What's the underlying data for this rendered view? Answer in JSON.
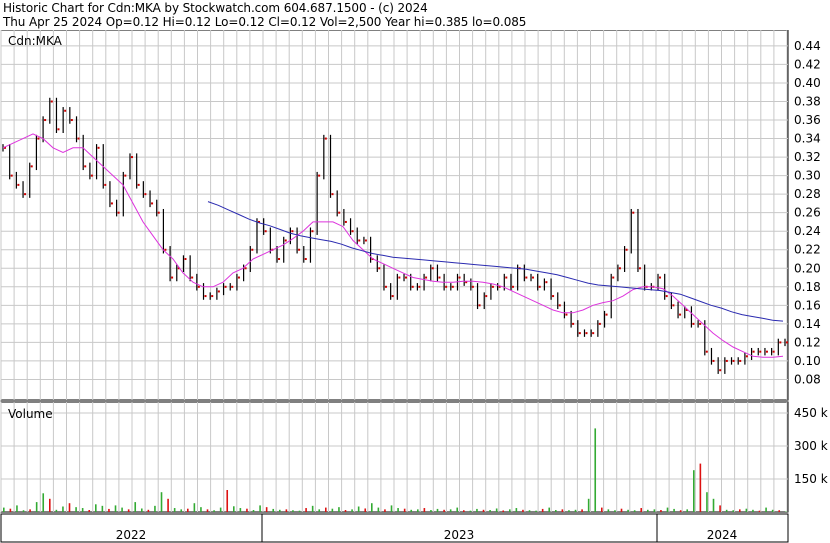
{
  "header": {
    "line1": "Historic Chart for Cdn:MKA by Stockwatch.com 604.687.1500 - (c) 2024",
    "line2": "Thu Apr 25 2024  Op=0.12  Hi=0.12  Lo=0.12  Cl=0.12  Vol=2,500  Year hi=0.385  lo=0.085"
  },
  "chart_data": [
    {
      "type": "ohlc",
      "panel": "price",
      "label": "Cdn:MKA",
      "y_ticks": [
        "0.08",
        "0.10",
        "0.12",
        "0.14",
        "0.16",
        "0.18",
        "0.20",
        "0.22",
        "0.24",
        "0.26",
        "0.28",
        "0.30",
        "0.32",
        "0.34",
        "0.36",
        "0.38",
        "0.40",
        "0.42",
        "0.44"
      ],
      "ylim": [
        0.06,
        0.455
      ],
      "x_labels": [
        "2022",
        "2023",
        "2024"
      ],
      "grid": true,
      "colors": {
        "bars": "#000000",
        "close_dots": "#cc0000",
        "ma_short": "#dd33dd",
        "ma_long": "#2a2ab0",
        "grid": "#c8c8c8"
      },
      "price_series": [
        0.33,
        0.3,
        0.29,
        0.28,
        0.31,
        0.34,
        0.36,
        0.38,
        0.35,
        0.37,
        0.36,
        0.34,
        0.31,
        0.3,
        0.33,
        0.29,
        0.27,
        0.26,
        0.3,
        0.32,
        0.29,
        0.28,
        0.27,
        0.26,
        0.22,
        0.19,
        0.2,
        0.21,
        0.19,
        0.18,
        0.17,
        0.17,
        0.175,
        0.18,
        0.18,
        0.19,
        0.2,
        0.22,
        0.25,
        0.24,
        0.22,
        0.21,
        0.23,
        0.24,
        0.22,
        0.21,
        0.24,
        0.3,
        0.34,
        0.28,
        0.26,
        0.25,
        0.24,
        0.23,
        0.23,
        0.21,
        0.2,
        0.18,
        0.17,
        0.19,
        0.19,
        0.18,
        0.18,
        0.19,
        0.2,
        0.19,
        0.18,
        0.18,
        0.19,
        0.185,
        0.18,
        0.16,
        0.17,
        0.18,
        0.18,
        0.19,
        0.18,
        0.2,
        0.19,
        0.19,
        0.18,
        0.185,
        0.17,
        0.16,
        0.15,
        0.14,
        0.13,
        0.13,
        0.13,
        0.14,
        0.15,
        0.19,
        0.2,
        0.22,
        0.26,
        0.2,
        0.18,
        0.18,
        0.19,
        0.17,
        0.16,
        0.15,
        0.155,
        0.14,
        0.14,
        0.11,
        0.1,
        0.09,
        0.1,
        0.1,
        0.1,
        0.105,
        0.11,
        0.11,
        0.11,
        0.11,
        0.12,
        0.12
      ],
      "ma_short": [
        0.33,
        0.335,
        0.34,
        0.345,
        0.34,
        0.33,
        0.325,
        0.33,
        0.33,
        0.32,
        0.31,
        0.3,
        0.29,
        0.27,
        0.25,
        0.235,
        0.22,
        0.21,
        0.195,
        0.185,
        0.18,
        0.18,
        0.185,
        0.195,
        0.2,
        0.21,
        0.215,
        0.22,
        0.225,
        0.232,
        0.24,
        0.25,
        0.25,
        0.25,
        0.245,
        0.23,
        0.22,
        0.21,
        0.205,
        0.2,
        0.195,
        0.19,
        0.188,
        0.186,
        0.185,
        0.185,
        0.186,
        0.186,
        0.185,
        0.183,
        0.18,
        0.175,
        0.17,
        0.165,
        0.16,
        0.155,
        0.152,
        0.152,
        0.155,
        0.16,
        0.163,
        0.165,
        0.17,
        0.177,
        0.18,
        0.18,
        0.178,
        0.17,
        0.16,
        0.15,
        0.14,
        0.13,
        0.122,
        0.115,
        0.11,
        0.105,
        0.104,
        0.104,
        0.105
      ],
      "ma_long": [
        0.272,
        0.268,
        0.263,
        0.258,
        0.253,
        0.249,
        0.246,
        0.242,
        0.238,
        0.235,
        0.233,
        0.231,
        0.229,
        0.226,
        0.222,
        0.219,
        0.216,
        0.214,
        0.212,
        0.211,
        0.21,
        0.209,
        0.208,
        0.207,
        0.206,
        0.205,
        0.204,
        0.203,
        0.202,
        0.201,
        0.2,
        0.199,
        0.197,
        0.195,
        0.193,
        0.19,
        0.187,
        0.184,
        0.182,
        0.181,
        0.18,
        0.179,
        0.178,
        0.177,
        0.176,
        0.174,
        0.172,
        0.168,
        0.164,
        0.16,
        0.157,
        0.153,
        0.15,
        0.148,
        0.146,
        0.144,
        0.143
      ]
    },
    {
      "type": "bar",
      "panel": "volume",
      "label": "Volume",
      "y_ticks": [
        "150 k",
        "300 k",
        "450 k"
      ],
      "ylim": [
        0,
        500000
      ],
      "colors": {
        "up": "#33aa33",
        "down": "#dd1111"
      },
      "volume_series": [
        20000,
        15000,
        30000,
        8000,
        12000,
        45000,
        85000,
        60000,
        10000,
        25000,
        40000,
        22000,
        18000,
        9000,
        35000,
        28000,
        14000,
        30000,
        20000,
        12000,
        45000,
        16000,
        10000,
        28000,
        90000,
        60000,
        18000,
        12000,
        15000,
        40000,
        22000,
        12000,
        8000,
        20000,
        100000,
        26000,
        18000,
        15000,
        9000,
        30000,
        22000,
        14000,
        10000,
        12000,
        8000,
        6000,
        18000,
        28000,
        12000,
        20000,
        15000,
        22000,
        9000,
        12000,
        25000,
        16000,
        40000,
        20000,
        12000,
        30000,
        18000,
        15000,
        10000,
        12000,
        18000,
        9000,
        14000,
        10000,
        12000,
        20000,
        8000,
        6000,
        14000,
        10000,
        9000,
        16000,
        7000,
        12000,
        18000,
        10000,
        8000,
        6000,
        14000,
        20000,
        9000,
        12000,
        8000,
        10000,
        12000,
        60000,
        380000,
        20000,
        12000,
        8000,
        15000,
        10000,
        8000,
        18000,
        10000,
        12000,
        9000,
        20000,
        14000,
        8000,
        12000,
        190000,
        220000,
        90000,
        60000,
        30000,
        10000,
        8000,
        12000,
        15000,
        10000,
        6000,
        20000,
        10000,
        8000,
        2500
      ]
    }
  ]
}
